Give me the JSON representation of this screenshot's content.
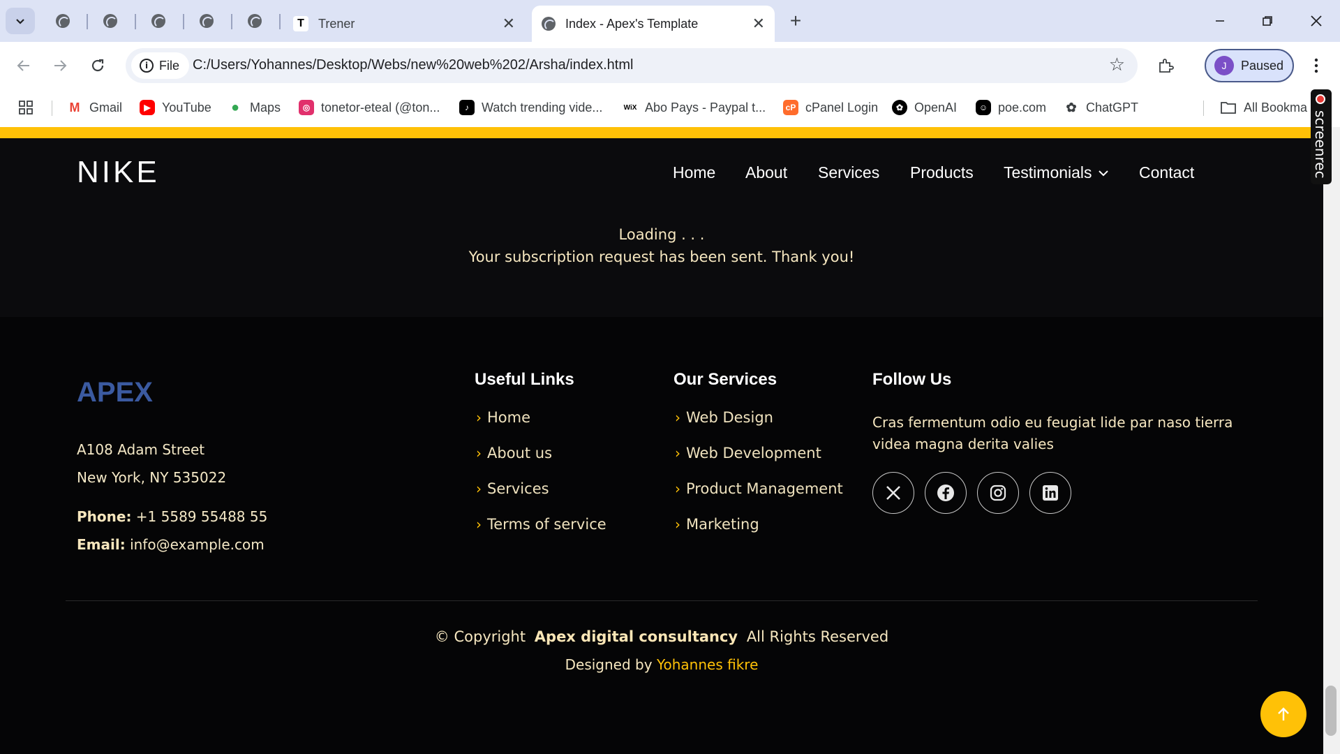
{
  "browser": {
    "tabs": [
      {
        "title": "Trener",
        "icon": "T"
      },
      {
        "title": "Index - Apex's Template",
        "icon": "globe"
      }
    ],
    "omnibox": {
      "chip": "File",
      "url": "C:/Users/Yohannes/Desktop/Webs/new%20web%202/Arsha/index.html"
    },
    "profile": {
      "initial": "J",
      "status": "Paused"
    },
    "bookmarks": [
      {
        "label": "Gmail"
      },
      {
        "label": "YouTube"
      },
      {
        "label": "Maps"
      },
      {
        "label": "tonetor-eteal (@ton..."
      },
      {
        "label": "Watch trending vide..."
      },
      {
        "label": "Abo Pays - Paypal t..."
      },
      {
        "label": "cPanel Login"
      },
      {
        "label": "OpenAI"
      },
      {
        "label": "poe.com"
      },
      {
        "label": "ChatGPT"
      },
      {
        "label": "All Bookma"
      }
    ],
    "screenrec": "screenrec"
  },
  "site": {
    "logo": "NIKE",
    "nav": [
      "Home",
      "About",
      "Services",
      "Products",
      "Testimonials",
      "Contact"
    ],
    "status": {
      "loading": "Loading . . .",
      "sent": "Your subscription request has been sent. Thank you!"
    },
    "footer": {
      "brand": "APEX",
      "address1": "A108 Adam Street",
      "address2": "New York, NY 535022",
      "phone_label": "Phone:",
      "phone": "+1 5589 55488 55",
      "email_label": "Email:",
      "email": "info@example.com",
      "useful_links_title": "Useful Links",
      "useful_links": [
        "Home",
        "About us",
        "Services",
        "Terms of service"
      ],
      "services_title": "Our Services",
      "services": [
        "Web Design",
        "Web Development",
        "Product Management",
        "Marketing"
      ],
      "follow_title": "Follow Us",
      "follow_text": "Cras fermentum odio eu feugiat lide par naso tierra videa magna derita valies",
      "socials": [
        "x-icon",
        "facebook-icon",
        "instagram-icon",
        "linkedin-icon"
      ],
      "copyright_prefix": "© Copyright",
      "copyright_name": "Apex digital consultancy",
      "copyright_suffix": "All Rights Reserved",
      "designed_prefix": "Designed by",
      "designer": "Yohannes fikre"
    }
  },
  "colors": {
    "accent": "#ffc107",
    "brand": "#3b5aa0",
    "background": "#0b0b0d"
  }
}
